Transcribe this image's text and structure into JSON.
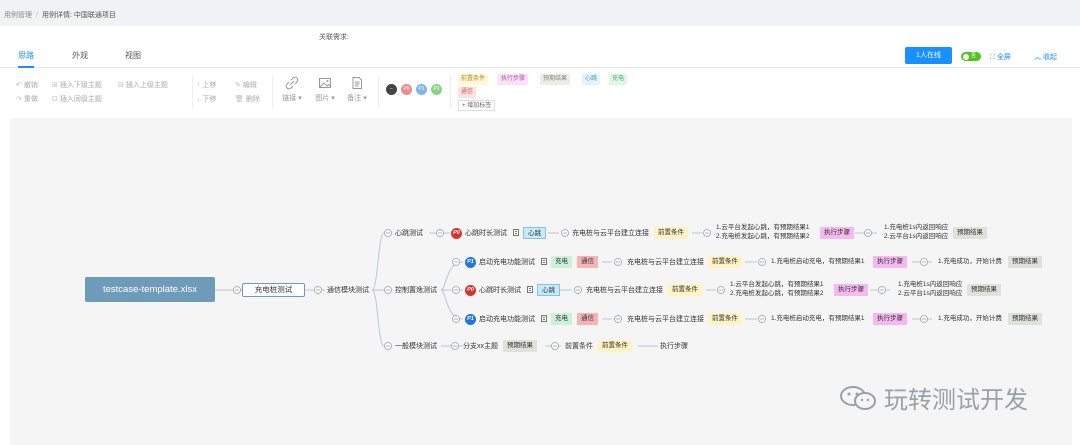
{
  "breadcrumb": [
    "用例管理",
    "用例详情: 中国联通项目"
  ],
  "header": {
    "related_req": "关联需求:"
  },
  "tabs": [
    "思路",
    "外观",
    "视图"
  ],
  "actions": {
    "online": "1人在线",
    "toggle_text": "否",
    "fullscreen": "全屏",
    "collapse": "收起"
  },
  "toolbar": {
    "undo": "撤销",
    "redo": "重做",
    "insert_child": "插入下级主题",
    "insert_parent": "插入上级主题",
    "insert_sibling": "插入同级主题",
    "move_up": "上移",
    "move_down": "下移",
    "edit": "编辑",
    "delete": "删除",
    "link": "链接",
    "image": "图片",
    "note": "备注",
    "priorities": [
      "P0",
      "P1",
      "P2"
    ],
    "tags": [
      "前置条件",
      "执行步骤",
      "预期结果",
      "心跳",
      "充电",
      "通信"
    ],
    "add_tag": "增加标签"
  },
  "mindmap": {
    "root": "testcase-template.xlsx",
    "level1": "充电桩测试",
    "level2": "通信模块测试",
    "groups": [
      "心跳测试",
      "控制置逸测试",
      "一般模块测试"
    ],
    "cases": [
      {
        "priority": "P0",
        "title": "心跳时长测试",
        "tags": [
          "心跳"
        ],
        "desc": "充电桩与云平台建立连接",
        "pre": "前置条件",
        "steps": [
          "1.云平台发起心跳，有预期结果1",
          "2.充电桩发起心跳，有预期结果2"
        ],
        "step_tag": "执行步骤",
        "results": [
          "1.充电桩1s内返回响应",
          "2.云平台1s内返回响应"
        ],
        "exp_tag": "预期结果"
      },
      {
        "priority": "P1",
        "title": "启动充电功能测试",
        "tags": [
          "充电",
          "通信"
        ],
        "desc": "充电桩与云平台建立连接",
        "pre": "前置条件",
        "steps": [
          "1.充电桩启动充电，有预期结果1"
        ],
        "step_tag": "执行步骤",
        "results": [
          "1.充电成功，开始计费"
        ],
        "exp_tag": "预期结果"
      },
      {
        "priority": "P0",
        "title": "心跳时长测试",
        "tags": [
          "心跳"
        ],
        "desc": "充电桩与云平台建立连接",
        "pre": "前置条件",
        "steps": [
          "1.云平台发起心跳，有预期结果1",
          "2.充电桩发起心跳，有预期结果2"
        ],
        "step_tag": "执行步骤",
        "results": [
          "1.充电桩1s内返回响应",
          "2.云平台1s内返回响应"
        ],
        "exp_tag": "预期结果"
      },
      {
        "priority": "P1",
        "title": "启动充电功能测试",
        "tags": [
          "充电",
          "通信"
        ],
        "desc": "充电桩与云平台建立连接",
        "pre": "前置条件",
        "steps": [
          "1.充电桩启动充电，有预期结果1"
        ],
        "step_tag": "执行步骤",
        "results": [
          "1.充电成功，开始计费"
        ],
        "exp_tag": "预期结果"
      }
    ],
    "branch": {
      "title": "分支xx主题",
      "exp_tag": "预期结果",
      "pre_label": "前置条件",
      "pre_tag": "前置条件",
      "step_label": "执行步骤"
    }
  },
  "watermark": "玩转测试开发"
}
